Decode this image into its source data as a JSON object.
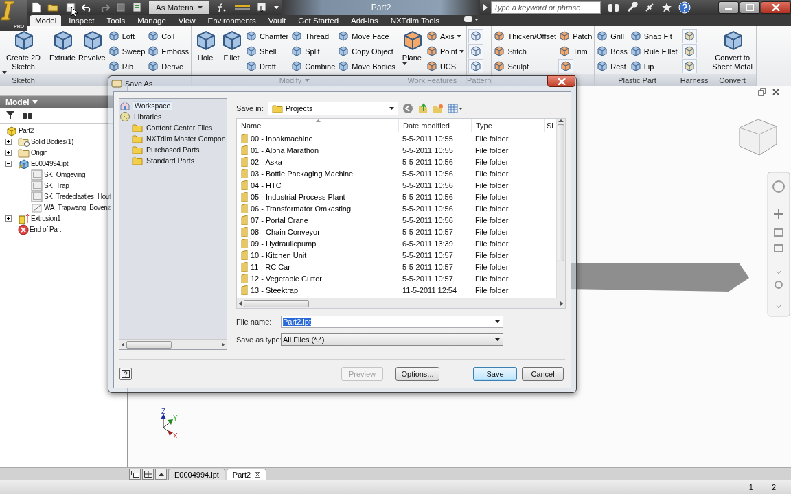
{
  "app": {
    "edition": "PRO",
    "title": "Part2",
    "material": "As Materia",
    "search": {
      "placeholder": "Type a keyword or phrase"
    }
  },
  "tabs": [
    {
      "label": "Model",
      "selected": true
    },
    {
      "label": "Inspect",
      "selected": false
    },
    {
      "label": "Tools",
      "selected": false
    },
    {
      "label": "Manage",
      "selected": false
    },
    {
      "label": "View",
      "selected": false
    },
    {
      "label": "Environments",
      "selected": false
    },
    {
      "label": "Vault",
      "selected": false
    },
    {
      "label": "Get Started",
      "selected": false
    },
    {
      "label": "Add-Ins",
      "selected": false
    },
    {
      "label": "NXTdim Tools",
      "selected": false
    }
  ],
  "panels": [
    {
      "title": "Sketch",
      "menu": false,
      "tools": [
        {
          "kind": "large",
          "label": "Create 2D Sketch",
          "dropdown": true
        }
      ]
    },
    {
      "tools": [
        {
          "kind": "large",
          "label": "Extrude",
          "dropdown": false
        },
        {
          "kind": "large",
          "label": "Revolve",
          "dropdown": false
        },
        {
          "kind": "small",
          "label": "Loft",
          "dropdown": false
        },
        {
          "kind": "small",
          "label": "Sweep",
          "dropdown": false
        },
        {
          "kind": "small",
          "label": "Rib",
          "dropdown": false
        },
        {
          "kind": "small",
          "label": "Coil",
          "dropdown": false
        },
        {
          "kind": "small",
          "label": "Emboss",
          "dropdown": false
        },
        {
          "kind": "small",
          "label": "Derive",
          "dropdown": false
        }
      ]
    },
    {
      "title": "Modify",
      "menu": true,
      "tools": [
        {
          "kind": "large",
          "label": "Hole",
          "dropdown": false
        },
        {
          "kind": "large",
          "label": "Fillet",
          "dropdown": false
        },
        {
          "kind": "small",
          "label": "Chamfer",
          "dropdown": false
        },
        {
          "kind": "small",
          "label": "Shell",
          "dropdown": false
        },
        {
          "kind": "small",
          "label": "Draft",
          "dropdown": false
        },
        {
          "kind": "small",
          "label": "Thread",
          "dropdown": false
        },
        {
          "kind": "small",
          "label": "Split",
          "dropdown": false
        },
        {
          "kind": "small",
          "label": "Combine",
          "dropdown": false
        },
        {
          "kind": "small",
          "label": "Move Face",
          "dropdown": false
        },
        {
          "kind": "small",
          "label": "Copy Object",
          "dropdown": false
        },
        {
          "kind": "small",
          "label": "Move Bodies",
          "dropdown": false
        }
      ]
    },
    {
      "title": "Work Features",
      "menu": false,
      "tools": [
        {
          "kind": "large",
          "label": "Plane",
          "dropdown": true
        },
        {
          "kind": "small",
          "label": "Axis",
          "dropdown": true
        },
        {
          "kind": "small",
          "label": "Point",
          "dropdown": true
        },
        {
          "kind": "small",
          "label": "UCS",
          "dropdown": false
        }
      ]
    },
    {
      "title": "Pattern",
      "menu": false,
      "tools": [
        {
          "kind": "icon"
        },
        {
          "kind": "icon"
        },
        {
          "kind": "icon"
        }
      ]
    },
    {
      "tools": [
        {
          "kind": "small",
          "label": "Thicken/Offset",
          "dropdown": false
        },
        {
          "kind": "small",
          "label": "Stitch",
          "dropdown": false
        },
        {
          "kind": "small",
          "label": "Sculpt",
          "dropdown": false
        },
        {
          "kind": "small",
          "label": "Patch",
          "dropdown": false
        },
        {
          "kind": "small",
          "label": "Trim",
          "dropdown": false
        },
        {
          "kind": "icon"
        }
      ]
    },
    {
      "title": "Plastic Part",
      "menu": false,
      "tools": [
        {
          "kind": "small",
          "label": "Grill",
          "dropdown": false
        },
        {
          "kind": "small",
          "label": "Boss",
          "dropdown": false
        },
        {
          "kind": "small",
          "label": "Rest",
          "dropdown": false
        },
        {
          "kind": "small",
          "label": "Snap Fit",
          "dropdown": false
        },
        {
          "kind": "small",
          "label": "Rule Fillet",
          "dropdown": false
        },
        {
          "kind": "small",
          "label": "Lip",
          "dropdown": false
        }
      ]
    },
    {
      "title": "Harness",
      "menu": false,
      "tools": [
        {
          "kind": "icon"
        },
        {
          "kind": "icon"
        },
        {
          "kind": "icon"
        }
      ]
    },
    {
      "title": "Convert",
      "menu": false,
      "tools": [
        {
          "kind": "large",
          "label": "Convert to Sheet Metal",
          "dropdown": false
        }
      ]
    }
  ],
  "browser": {
    "title": "Model",
    "tree": [
      {
        "label": "Part2",
        "kind": "part",
        "children": [
          {
            "label": "Solid Bodies(1)",
            "kind": "bodies",
            "expanded": false
          },
          {
            "label": "Origin",
            "kind": "folder",
            "expanded": false
          },
          {
            "label": "E0004994.ipt",
            "kind": "derived",
            "expanded": true,
            "children": [
              {
                "label": "SK_Omgeving",
                "kind": "sketch"
              },
              {
                "label": "SK_Trap",
                "kind": "sketch"
              },
              {
                "label": "SK_Tredeplaatjes_Hout",
                "kind": "sketch"
              },
              {
                "label": "WA_Trapwang_Bovenz",
                "kind": "plane"
              }
            ]
          },
          {
            "label": "Extrusion1",
            "kind": "feature",
            "expanded": false
          },
          {
            "label": "End of Part",
            "kind": "end"
          }
        ]
      }
    ]
  },
  "viewport": {
    "axis_labels": {
      "z": "Z",
      "y": "Y",
      "x": "X"
    }
  },
  "document_tabs": [
    {
      "label": "E0004994.ipt",
      "selected": false
    },
    {
      "label": "Part2",
      "selected": true
    }
  ],
  "status_bar": [
    "1",
    "2"
  ],
  "dialog": {
    "title": "Save As",
    "places": [
      {
        "label": "Workspace",
        "kind": "workspace",
        "selected": true
      },
      {
        "label": "Libraries",
        "kind": "library",
        "selected": false,
        "children": [
          {
            "label": "Content Center Files",
            "kind": "folder",
            "selected": false
          },
          {
            "label": "NXTdim Master Compon",
            "kind": "folder",
            "selected": false
          },
          {
            "label": "Purchased Parts",
            "kind": "folder",
            "selected": false
          },
          {
            "label": "Standard Parts",
            "kind": "folder",
            "selected": false
          }
        ]
      }
    ],
    "save_in": {
      "label": "Save in:",
      "value": "Projects"
    },
    "columns": [
      "Name",
      "Date modified",
      "Type",
      "Si"
    ],
    "rows": [
      {
        "name": "00 - Inpakmachine",
        "date": "5-5-2011 10:55",
        "type": "File folder",
        "selected": false
      },
      {
        "name": "01 - Alpha Marathon",
        "date": "5-5-2011 10:55",
        "type": "File folder",
        "selected": false
      },
      {
        "name": "02 - Aska",
        "date": "5-5-2011 10:56",
        "type": "File folder",
        "selected": false
      },
      {
        "name": "03 - Bottle Packaging Machine",
        "date": "5-5-2011 10:56",
        "type": "File folder",
        "selected": false
      },
      {
        "name": "04 - HTC",
        "date": "5-5-2011 10:56",
        "type": "File folder",
        "selected": false
      },
      {
        "name": "05 - Industrial Process Plant",
        "date": "5-5-2011 10:56",
        "type": "File folder",
        "selected": false
      },
      {
        "name": "06 - Transformator Omkasting",
        "date": "5-5-2011 10:56",
        "type": "File folder",
        "selected": false
      },
      {
        "name": "07 - Portal Crane",
        "date": "5-5-2011 10:56",
        "type": "File folder",
        "selected": false
      },
      {
        "name": "08 - Chain Conveyor",
        "date": "5-5-2011 10:57",
        "type": "File folder",
        "selected": false
      },
      {
        "name": "09 - Hydraulicpump",
        "date": "6-5-2011 13:39",
        "type": "File folder",
        "selected": false
      },
      {
        "name": "10 - Kitchen Unit",
        "date": "5-5-2011 10:57",
        "type": "File folder",
        "selected": false
      },
      {
        "name": "11 - RC Car",
        "date": "5-5-2011 10:57",
        "type": "File folder",
        "selected": false
      },
      {
        "name": "12 - Vegetable Cutter",
        "date": "5-5-2011 10:57",
        "type": "File folder",
        "selected": false
      },
      {
        "name": "13 - Steektrap",
        "date": "11-5-2011 12:54",
        "type": "File folder",
        "selected": false
      }
    ],
    "file_name": {
      "label": "File name:",
      "value": "Part2.ipt",
      "highlighted": true
    },
    "save_as_type": {
      "label": "Save as type:",
      "value": "All Files (*.*)"
    },
    "buttons": [
      {
        "label": "Preview",
        "disabled": true,
        "default": false
      },
      {
        "label": "Options...",
        "disabled": false,
        "default": false
      },
      {
        "label": "Save",
        "disabled": false,
        "default": true
      },
      {
        "label": "Cancel",
        "disabled": false,
        "default": false
      }
    ]
  }
}
